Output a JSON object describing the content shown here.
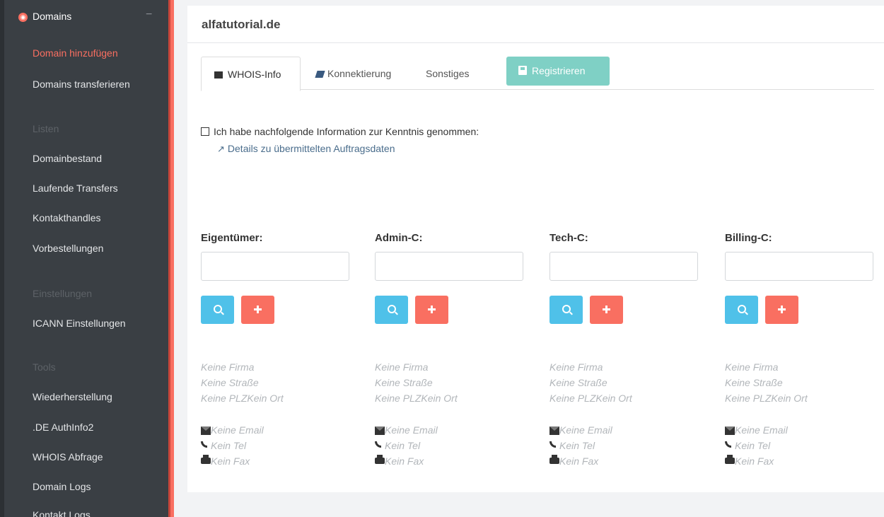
{
  "sidebar": {
    "header": "Domains",
    "collapse_icon": "minus-icon",
    "items": [
      {
        "label": "Domain hinzufügen",
        "active": true
      },
      {
        "label": "Domains transferieren"
      }
    ],
    "sections": [
      {
        "title": "Listen",
        "items": [
          "Domainbestand",
          "Laufende Transfers",
          "Kontakthandles",
          "Vorbestellungen"
        ]
      },
      {
        "title": "Einstellungen",
        "items": [
          "ICANN Einstellungen"
        ]
      },
      {
        "title": "Tools",
        "items": [
          "Wiederherstellung",
          ".DE AuthInfo2",
          "WHOIS Abfrage",
          "Domain Logs",
          "Kontakt Logs"
        ]
      }
    ],
    "colors": {
      "background": "#3a3f44",
      "accent": "#f96f61",
      "section": "#5d6267"
    }
  },
  "main": {
    "domain": "alfatutorial.de",
    "tabs": [
      {
        "label": "WHOIS-Info",
        "icon": "archive-icon",
        "active": true
      },
      {
        "label": "Konnektierung",
        "icon": "book-icon"
      },
      {
        "label": "Sonstiges"
      }
    ],
    "register_button": {
      "label": "Registrieren",
      "icon": "floppy-disk-icon",
      "color": "#7fd0c5"
    },
    "acknowledge": {
      "checkbox_label": "Ich habe nachfolgende Information zur Kenntnis genommen:",
      "checked": false,
      "link": "Details zu übermittelten Auftragsdaten"
    },
    "contacts": [
      {
        "role": "Eigentümer:",
        "value": "",
        "firma": "Keine Firma",
        "strasse": "Keine Straße",
        "ort": "Keine PLZKein Ort",
        "email": "Keine Email",
        "tel": "Kein Tel",
        "fax": "Kein Fax"
      },
      {
        "role": "Admin-C:",
        "value": "",
        "firma": "Keine Firma",
        "strasse": "Keine Straße",
        "ort": "Keine PLZKein Ort",
        "email": "Keine Email",
        "tel": "Kein Tel",
        "fax": "Kein Fax"
      },
      {
        "role": "Tech-C:",
        "value": "",
        "firma": "Keine Firma",
        "strasse": "Keine Straße",
        "ort": "Keine PLZKein Ort",
        "email": "Keine Email",
        "tel": "Kein Tel",
        "fax": "Kein Fax"
      },
      {
        "role": "Billing-C:",
        "value": "",
        "firma": "Keine Firma",
        "strasse": "Keine Straße",
        "ort": "Keine PLZKein Ort",
        "email": "Keine Email",
        "tel": "Kein Tel",
        "fax": "Kein Fax"
      }
    ],
    "colors": {
      "search_button": "#4fc1e9",
      "add_button": "#f96f61",
      "placeholder_text": "#b2b6ba"
    }
  }
}
